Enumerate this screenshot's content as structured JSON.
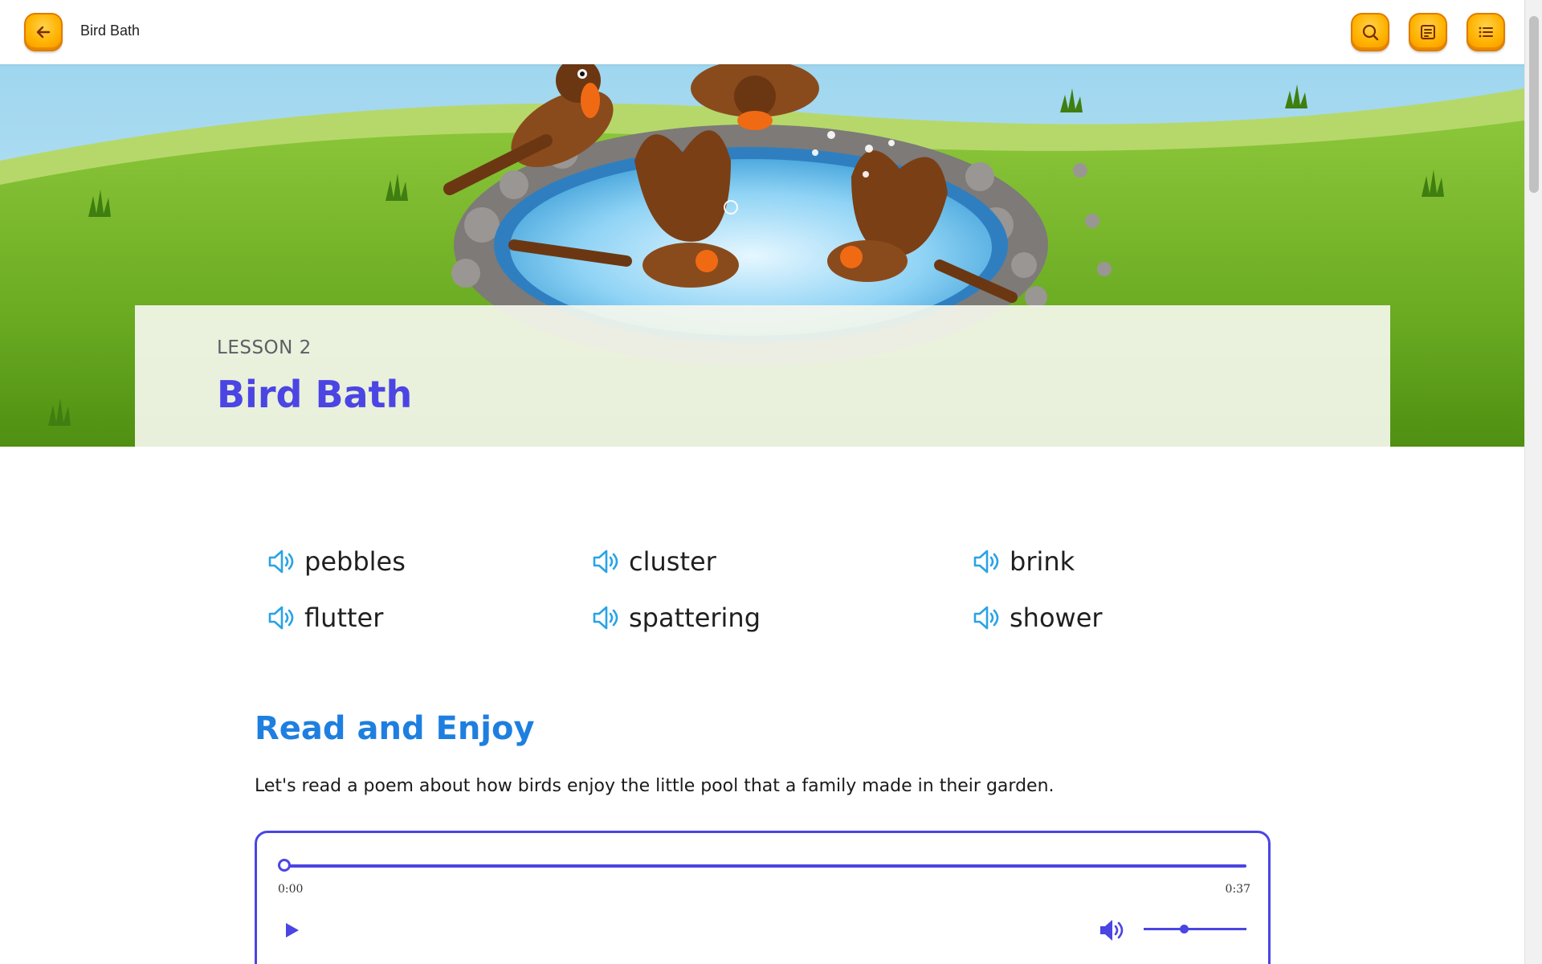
{
  "header": {
    "title": "Bird Bath",
    "buttons": {
      "back": "arrow-left-icon",
      "search": "search-icon",
      "notes": "notes-icon",
      "menu": "list-icon"
    }
  },
  "hero": {
    "image": "birds-splashing-in-bird-bath-illustration",
    "lesson_label": "LESSON 2",
    "lesson_title": "Bird Bath"
  },
  "vocabulary": [
    {
      "word": "pebbles",
      "icon": "speaker-icon"
    },
    {
      "word": "cluster",
      "icon": "speaker-icon"
    },
    {
      "word": "brink",
      "icon": "speaker-icon"
    },
    {
      "word": "flutter",
      "icon": "speaker-icon"
    },
    {
      "word": "spattering",
      "icon": "speaker-icon"
    },
    {
      "word": "shower",
      "icon": "speaker-icon"
    }
  ],
  "section": {
    "title": "Read and Enjoy",
    "intro": "Let's read a poem about how birds enjoy the little pool that a family made in their garden."
  },
  "player": {
    "current_time": "0:00",
    "total_time": "0:37",
    "progress": 0,
    "volume": 0.42
  },
  "colors": {
    "accent": "#4b45e3",
    "heading_blue": "#1e7fe0",
    "speaker_blue": "#29a3e6",
    "button_orange": "#ffb300"
  }
}
